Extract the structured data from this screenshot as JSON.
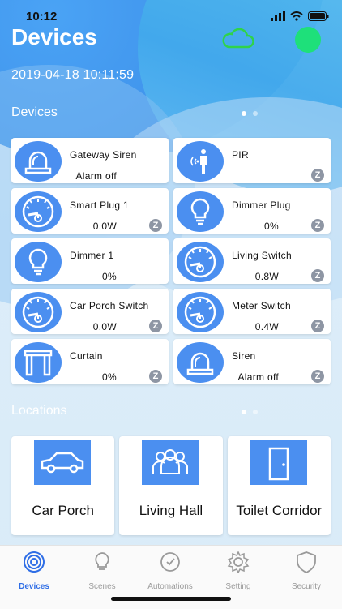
{
  "status_bar": {
    "time": "10:12"
  },
  "header": {
    "title": "Devices",
    "datetime": "2019-04-18 10:11:59"
  },
  "colors": {
    "accent": "#4b8ff0",
    "online": "#1ee07a",
    "cloud": "#2fd34a",
    "tab_active": "#2f6ee6"
  },
  "devices_section": {
    "label": "Devices",
    "items": [
      {
        "name": "Gateway Siren",
        "value": "Alarm off",
        "icon": "siren-icon",
        "zigbee": false
      },
      {
        "name": "PIR",
        "value": "",
        "icon": "motion-sensor-icon",
        "zigbee": true
      },
      {
        "name": "Smart Plug 1",
        "value": "0.0W",
        "icon": "gauge-icon",
        "zigbee": true
      },
      {
        "name": "Dimmer Plug",
        "value": "0%",
        "icon": "bulb-icon",
        "zigbee": true
      },
      {
        "name": "Dimmer 1",
        "value": "0%",
        "icon": "bulb-icon",
        "zigbee": false
      },
      {
        "name": "Living Switch",
        "value": "0.8W",
        "icon": "gauge-icon",
        "zigbee": true
      },
      {
        "name": "Car Porch Switch",
        "value": "0.0W",
        "icon": "gauge-icon",
        "zigbee": true
      },
      {
        "name": "Meter Switch",
        "value": "0.4W",
        "icon": "gauge-icon",
        "zigbee": true
      },
      {
        "name": "Curtain",
        "value": "0%",
        "icon": "curtain-icon",
        "zigbee": true
      },
      {
        "name": "Siren",
        "value": "Alarm off",
        "icon": "siren-icon",
        "zigbee": true
      }
    ]
  },
  "locations_section": {
    "label": "Locations",
    "items": [
      {
        "name": "Car Porch",
        "icon": "car-icon"
      },
      {
        "name": "Living Hall",
        "icon": "people-icon"
      },
      {
        "name": "Toilet Corridor",
        "icon": "door-icon"
      }
    ]
  },
  "tabbar": {
    "tabs": [
      {
        "label": "Devices",
        "icon": "devices-icon",
        "active": true
      },
      {
        "label": "Scenes",
        "icon": "scenes-icon",
        "active": false
      },
      {
        "label": "Automations",
        "icon": "automations-icon",
        "active": false
      },
      {
        "label": "Setting",
        "icon": "gear-icon",
        "active": false
      },
      {
        "label": "Security",
        "icon": "shield-icon",
        "active": false
      }
    ]
  }
}
